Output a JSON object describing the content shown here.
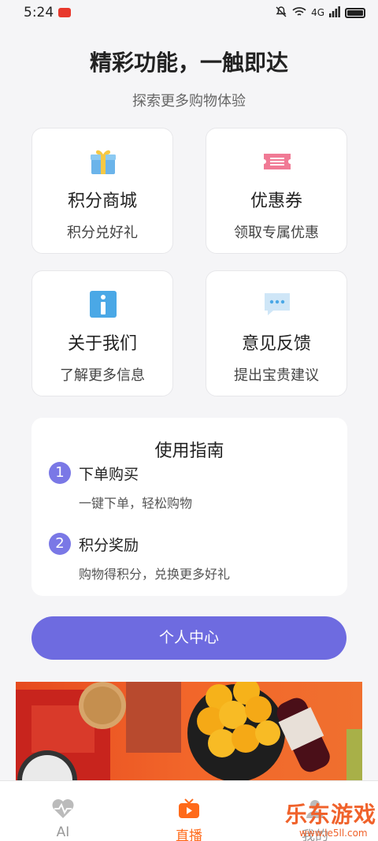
{
  "status_bar": {
    "time": "5:24",
    "network": "4G"
  },
  "header": {
    "title": "精彩功能，一触即达",
    "subtitle": "探索更多购物体验"
  },
  "cards": [
    {
      "title": "积分商城",
      "desc": "积分兑好礼",
      "icon": "gift-icon"
    },
    {
      "title": "优惠券",
      "desc": "领取专属优惠",
      "icon": "coupon-icon"
    },
    {
      "title": "关于我们",
      "desc": "了解更多信息",
      "icon": "info-icon"
    },
    {
      "title": "意见反馈",
      "desc": "提出宝贵建议",
      "icon": "chat-bubble-icon"
    }
  ],
  "guide": {
    "title": "使用指南",
    "steps": [
      {
        "num": "1",
        "title": "下单购买",
        "desc": "一键下单，轻松购物"
      },
      {
        "num": "2",
        "title": "积分奖励",
        "desc": "购物得积分，兑换更多好礼"
      }
    ]
  },
  "primary_button": {
    "label": "个人中心"
  },
  "tabs": [
    {
      "label": "AI",
      "icon": "heartbeat-icon"
    },
    {
      "label": "直播",
      "icon": "tv-icon"
    },
    {
      "label": "我的",
      "icon": "person-icon"
    }
  ],
  "watermark": {
    "text": "乐东游戏",
    "url": "www.le5ll.com"
  },
  "colors": {
    "accent": "#6e6be0",
    "tab_active": "#ff6a1a",
    "background": "#f5f5f7"
  }
}
